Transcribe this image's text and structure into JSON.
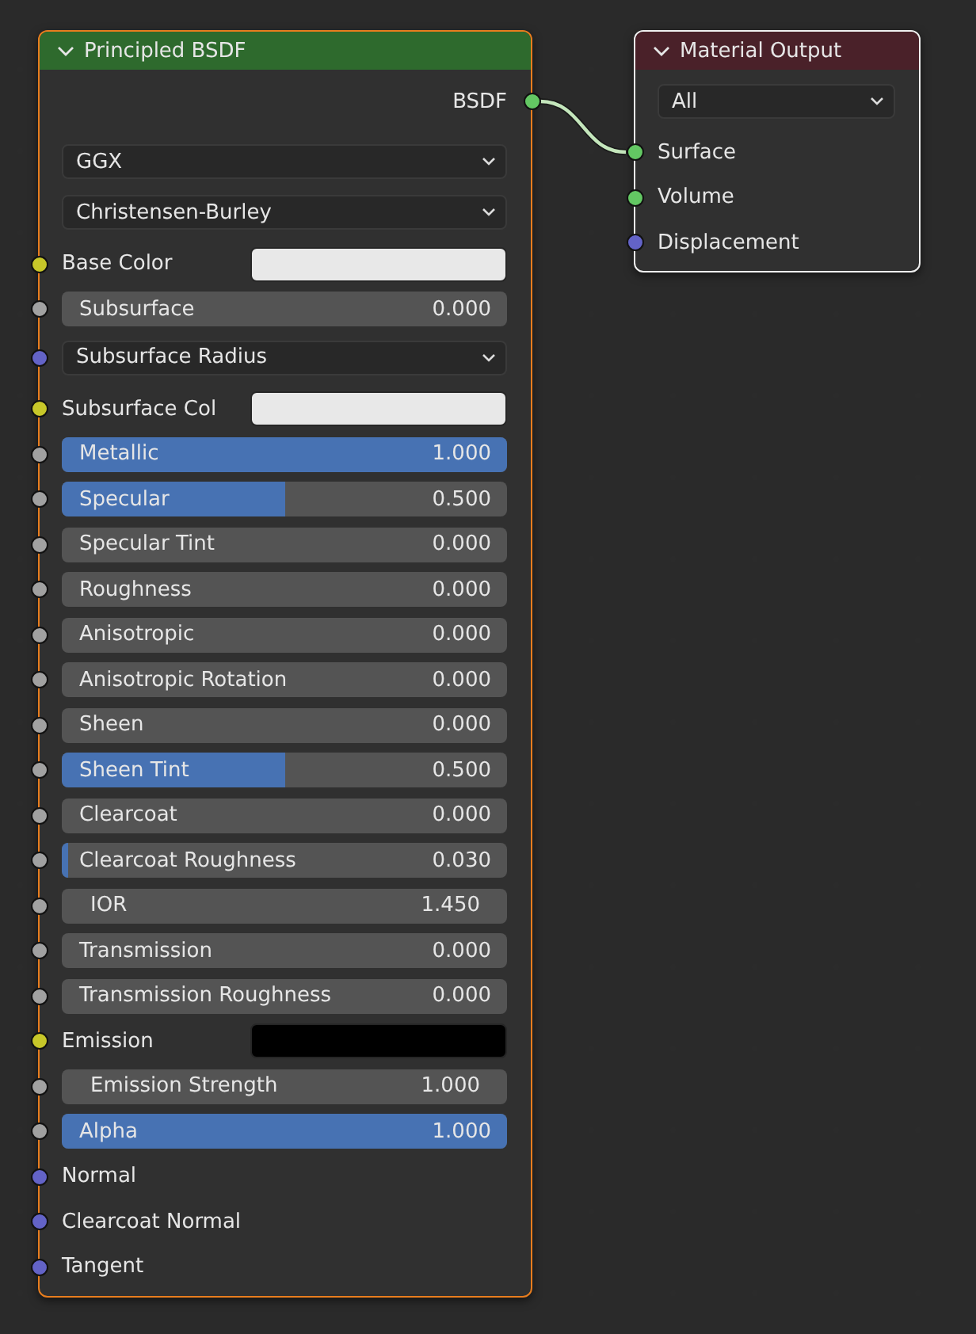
{
  "nodes": [
    {
      "title": "Principled BSDF",
      "kind": "shader",
      "selected": true,
      "active": true,
      "rows": [
        {
          "kind": "output",
          "label": "BSDF",
          "color": "#63c763"
        },
        {
          "kind": "menu",
          "value": "GGX"
        },
        {
          "kind": "menu",
          "value": "Christensen-Burley"
        },
        {
          "kind": "color",
          "label": "Base Color",
          "swatch": {
            "color": "#e8e8e8"
          },
          "color": "#c7c729"
        },
        {
          "kind": "slider",
          "label": "Subsurface",
          "value": "0.000",
          "level": 0,
          "color": "#a1a1a1"
        },
        {
          "kind": "menu",
          "value": "Subsurface Radius",
          "color": "#6363c7"
        },
        {
          "kind": "color",
          "label": "Subsurface Col",
          "swatch": {
            "color": "#e8e8e8"
          },
          "color": "#c7c729"
        },
        {
          "kind": "slider",
          "label": "Metallic",
          "value": "1.000",
          "level": 1,
          "color": "#a1a1a1"
        },
        {
          "kind": "slider",
          "label": "Specular",
          "value": "0.500",
          "level": 0.5,
          "color": "#a1a1a1"
        },
        {
          "kind": "slider",
          "label": "Specular Tint",
          "value": "0.000",
          "level": 0,
          "color": "#a1a1a1"
        },
        {
          "kind": "slider",
          "label": "Roughness",
          "value": "0.000",
          "level": 0,
          "color": "#a1a1a1"
        },
        {
          "kind": "slider",
          "label": "Anisotropic",
          "value": "0.000",
          "level": 0,
          "color": "#a1a1a1"
        },
        {
          "kind": "slider",
          "label": "Anisotropic Rotation",
          "value": "0.000",
          "level": 0,
          "color": "#a1a1a1"
        },
        {
          "kind": "slider",
          "label": "Sheen",
          "value": "0.000",
          "level": 0,
          "color": "#a1a1a1"
        },
        {
          "kind": "slider",
          "label": "Sheen Tint",
          "value": "0.500",
          "level": 0.5,
          "color": "#a1a1a1"
        },
        {
          "kind": "slider",
          "label": "Clearcoat",
          "value": "0.000",
          "level": 0,
          "color": "#a1a1a1"
        },
        {
          "kind": "slider",
          "label": "Clearcoat Roughness",
          "value": "0.030",
          "level": 0.03,
          "color": "#a1a1a1"
        },
        {
          "kind": "number",
          "label": "IOR",
          "value": "1.450",
          "color": "#a1a1a1"
        },
        {
          "kind": "slider",
          "label": "Transmission",
          "value": "0.000",
          "level": 0,
          "color": "#a1a1a1"
        },
        {
          "kind": "slider",
          "label": "Transmission Roughness",
          "value": "0.000",
          "level": 0,
          "color": "#a1a1a1"
        },
        {
          "kind": "color",
          "label": "Emission",
          "swatch": {
            "color": "#000000"
          },
          "color": "#c7c729"
        },
        {
          "kind": "number",
          "label": "Emission Strength",
          "value": "1.000",
          "color": "#a1a1a1"
        },
        {
          "kind": "slider",
          "label": "Alpha",
          "value": "1.000",
          "level": 1,
          "color": "#a1a1a1"
        },
        {
          "kind": "input",
          "label": "Normal",
          "color": "#6363c7"
        },
        {
          "kind": "input",
          "label": "Clearcoat Normal",
          "color": "#6363c7"
        },
        {
          "kind": "input",
          "label": "Tangent",
          "color": "#6363c7"
        }
      ]
    },
    {
      "title": "Material Output",
      "kind": "output",
      "selected": true,
      "active": false,
      "rows": [
        {
          "kind": "menu",
          "value": "All"
        },
        {
          "kind": "input",
          "label": "Surface",
          "color": "#63c763"
        },
        {
          "kind": "input",
          "label": "Volume",
          "color": "#63c763"
        },
        {
          "kind": "input",
          "label": "Displacement",
          "color": "#6363c7"
        }
      ]
    }
  ]
}
